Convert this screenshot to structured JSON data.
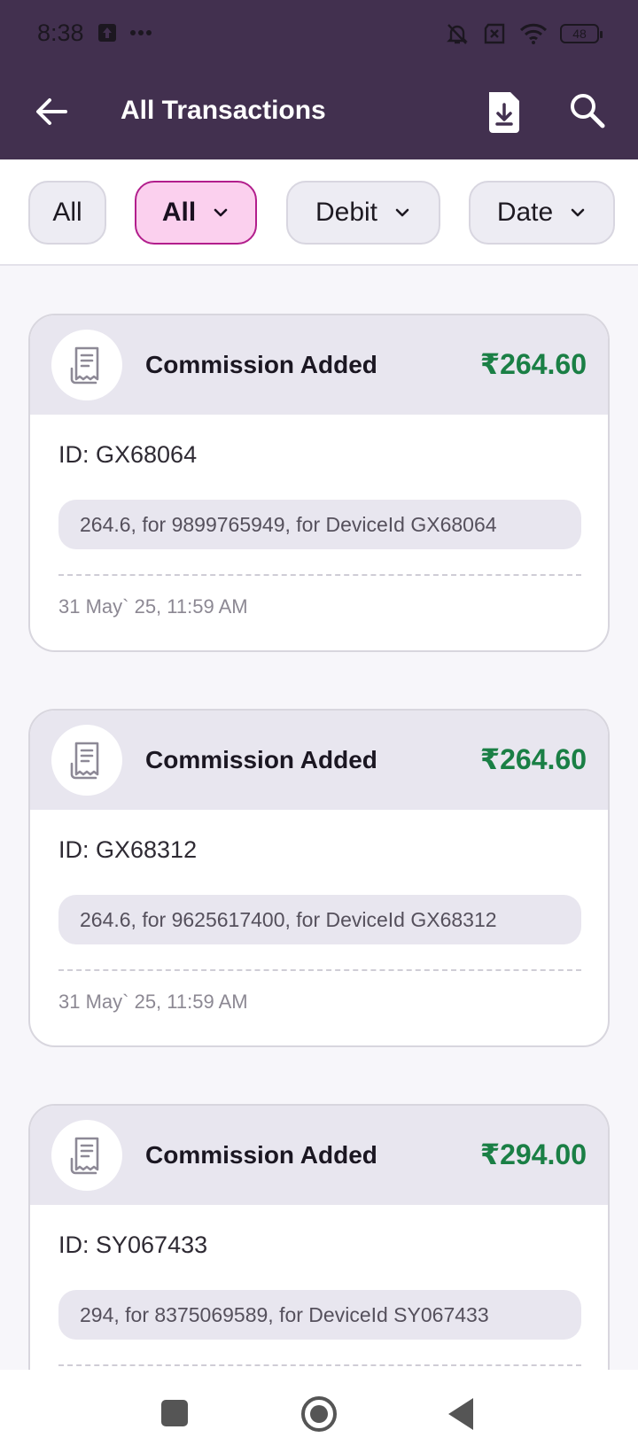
{
  "status_bar": {
    "time": "8:38",
    "battery": "48"
  },
  "header": {
    "title": "All Transactions"
  },
  "filters": [
    {
      "label": "All",
      "dropdown": false,
      "active": false
    },
    {
      "label": "All",
      "dropdown": true,
      "active": true
    },
    {
      "label": "Debit",
      "dropdown": true,
      "active": false
    },
    {
      "label": "Date",
      "dropdown": true,
      "active": false
    }
  ],
  "transactions": [
    {
      "title": "Commission Added",
      "amount": "₹264.60",
      "id": "ID: GX68064",
      "description": "264.6, for 9899765949, for DeviceId GX68064",
      "datetime": "31 May` 25, 11:59 AM"
    },
    {
      "title": "Commission Added",
      "amount": "₹264.60",
      "id": "ID: GX68312",
      "description": "264.6, for 9625617400, for DeviceId GX68312",
      "datetime": "31 May` 25, 11:59 AM"
    },
    {
      "title": "Commission Added",
      "amount": "₹294.00",
      "id": "ID: SY067433",
      "description": "294, for 8375069589, for DeviceId SY067433",
      "datetime": ""
    }
  ],
  "colors": {
    "appbar": "#42304f",
    "amount": "#1a7f45",
    "active_chip_bg": "#fbd0ee",
    "active_chip_border": "#b21e8c"
  },
  "icons": [
    "back-arrow-icon",
    "download-icon",
    "search-icon",
    "chevron-down-icon",
    "receipt-icon"
  ]
}
